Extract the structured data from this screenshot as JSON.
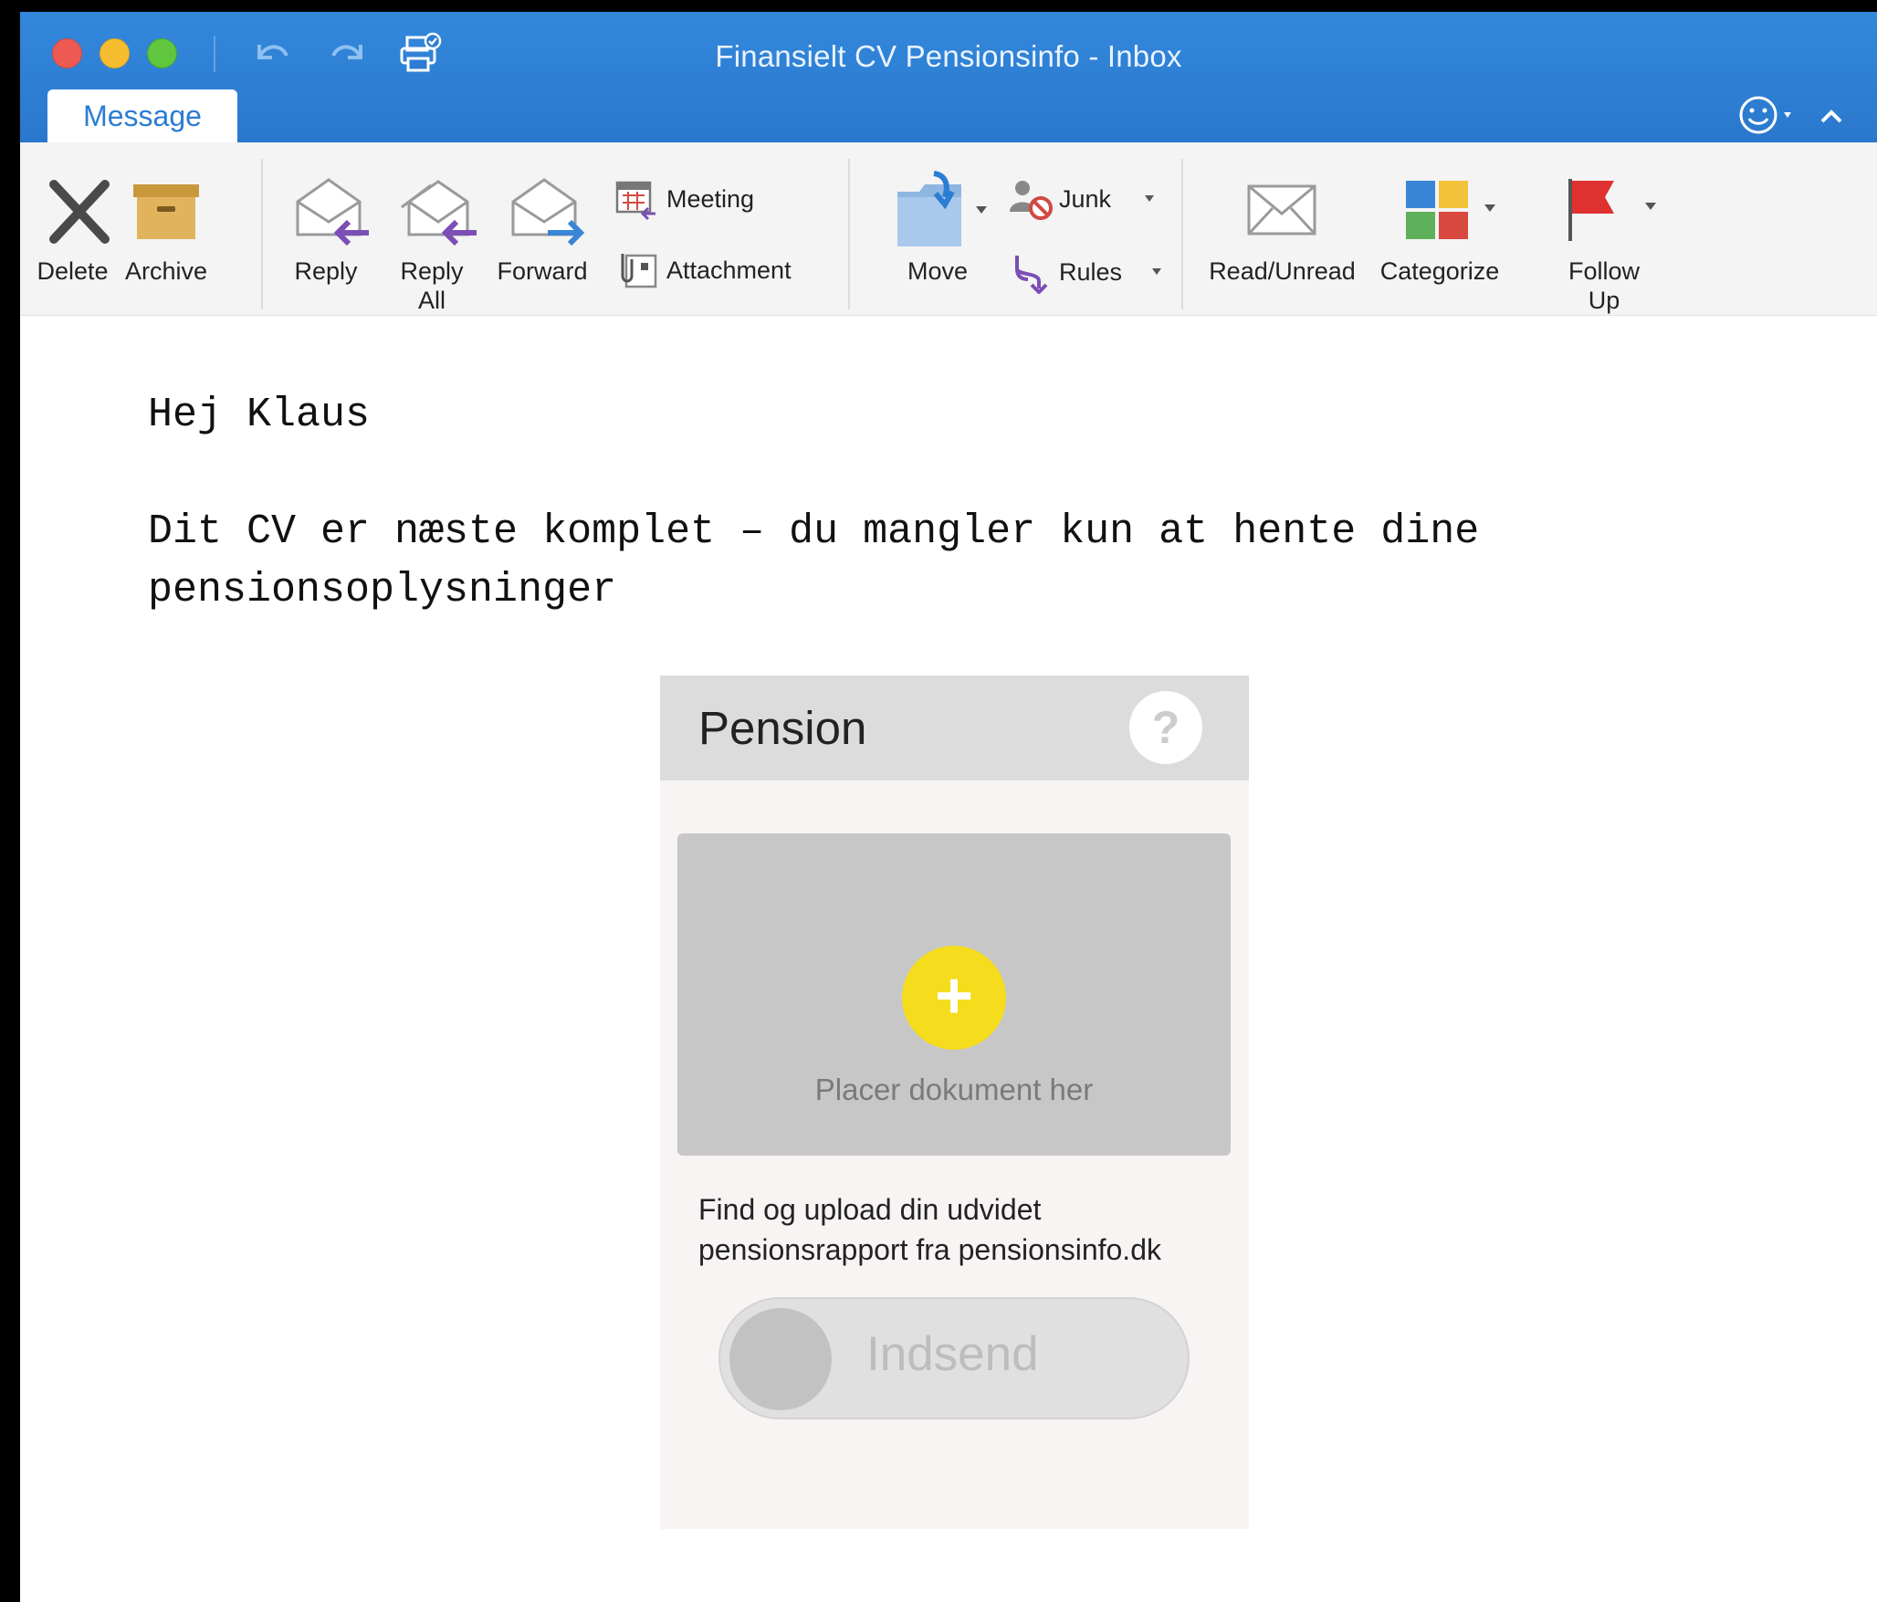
{
  "window": {
    "title": "Finansielt CV Pensionsinfo - Inbox",
    "active_tab": "Message"
  },
  "ribbon": {
    "delete": "Delete",
    "archive": "Archive",
    "reply": "Reply",
    "reply_all": "Reply All",
    "forward": "Forward",
    "meeting": "Meeting",
    "attachment": "Attachment",
    "move": "Move",
    "junk": "Junk",
    "rules": "Rules",
    "read_unread": "Read/Unread",
    "categorize": "Categorize",
    "follow_up": "Follow Up"
  },
  "mail": {
    "greeting": "Hej Klaus",
    "body": "Dit CV er næste komplet – du mangler kun at hente dine pensionsoplysninger"
  },
  "pension_card": {
    "title": "Pension",
    "help_symbol": "?",
    "plus_symbol": "+",
    "drop_label": "Placer dokument her",
    "description": "Find og upload din udvidet pensionsrapport fra pensionsinfo.dk",
    "submit_label": "Indsend"
  },
  "colors": {
    "titlebar": "#2b7cd3",
    "accent_yellow": "#f5dc1d",
    "flag_red": "#e03131",
    "arrow_purple": "#7b4fb5"
  }
}
